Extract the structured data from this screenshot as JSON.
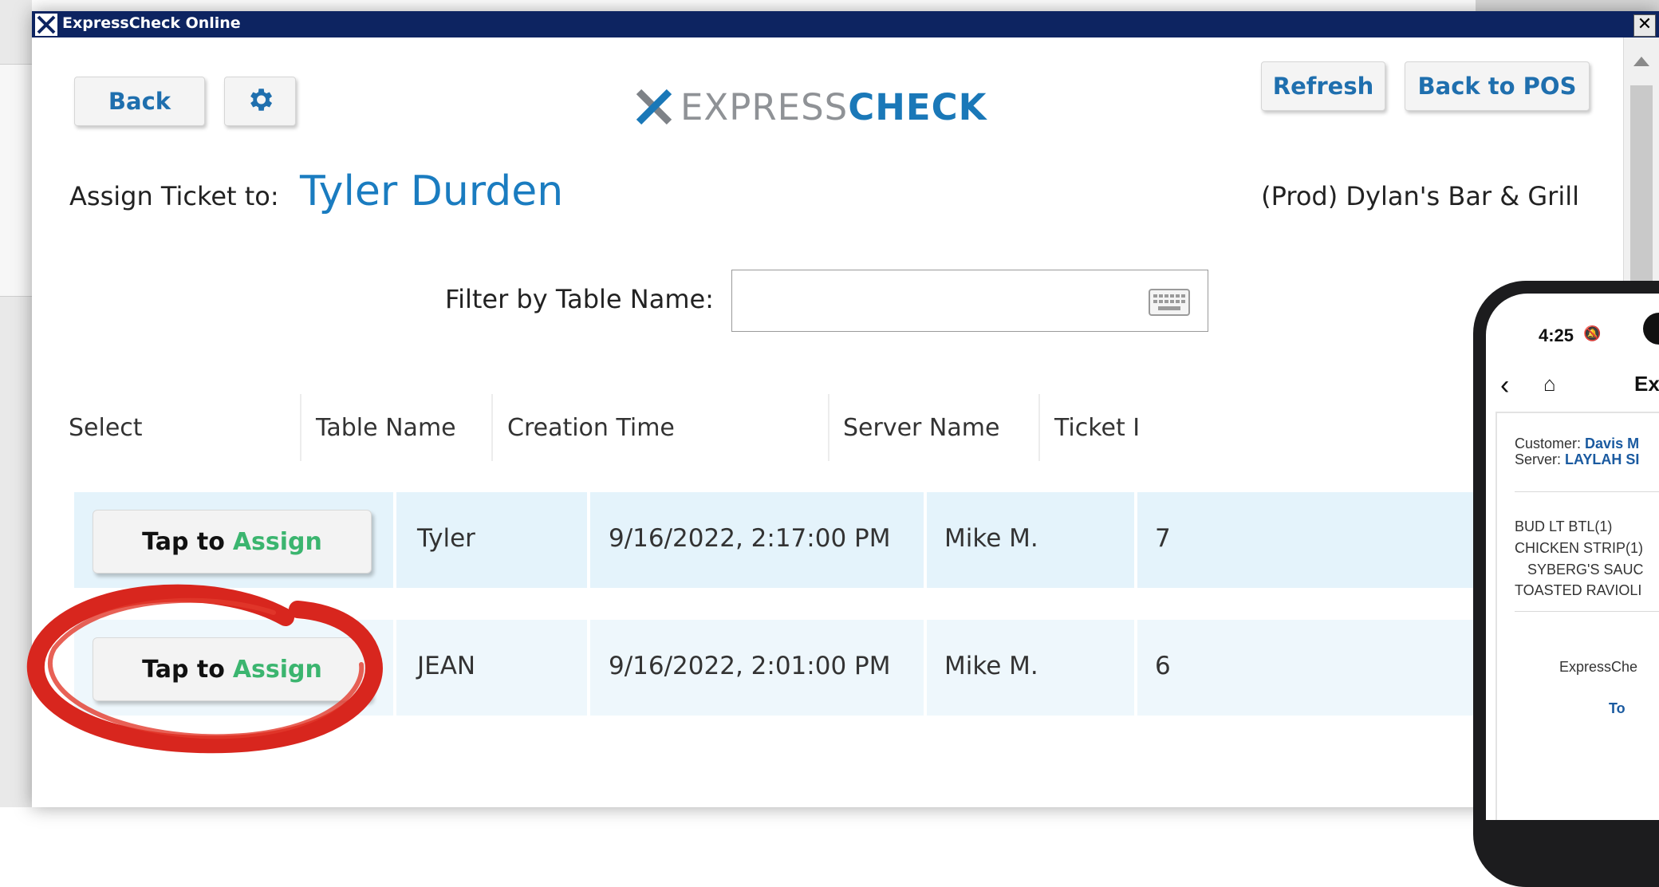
{
  "window": {
    "title": "ExpressCheck Online",
    "close_glyph": "✕"
  },
  "toolbar": {
    "back_label": "Back",
    "gear_icon": "gear-icon",
    "refresh_label": "Refresh",
    "back_to_pos_label": "Back to POS"
  },
  "logo": {
    "express": "EXPRESS",
    "check": "CHECK"
  },
  "assign": {
    "label": "Assign Ticket to:",
    "name": "Tyler Durden"
  },
  "location": "(Prod) Dylan's Bar & Grill",
  "filter": {
    "label": "Filter by Table Name:",
    "value": "",
    "keyboard_icon": "keyboard-icon"
  },
  "table": {
    "columns": [
      "Select",
      "Table Name",
      "Creation Time",
      "Server Name",
      "Ticket I"
    ],
    "rows": [
      {
        "select_prefix": "Tap to",
        "select_action": "Assign",
        "table_name": "Tyler",
        "creation_time": "9/16/2022, 2:17:00 PM",
        "server_name": "Mike M.",
        "ticket": "7"
      },
      {
        "select_prefix": "Tap to",
        "select_action": "Assign",
        "table_name": "JEAN",
        "creation_time": "9/16/2022, 2:01:00 PM",
        "server_name": "Mike M.",
        "ticket": "6"
      }
    ]
  },
  "phone": {
    "time": "4:25",
    "title": "Ex",
    "customer_label": "Customer:",
    "customer_value": "Davis M",
    "server_label": "Server:",
    "server_value": "LAYLAH SI",
    "items": [
      "BUD LT BTL(1)",
      "CHICKEN STRIP(1)",
      "SYBERG'S SAUC",
      "TOASTED RAVIOLI"
    ],
    "footer_text": "ExpressChe",
    "bottom_text": "To"
  },
  "colors": {
    "titlebar": "#0d2461",
    "accent_blue": "#1a7cc0",
    "assign_green": "#3bb56f",
    "row_highlight": "#e4f3fb",
    "annotation_red": "#d8261e"
  }
}
